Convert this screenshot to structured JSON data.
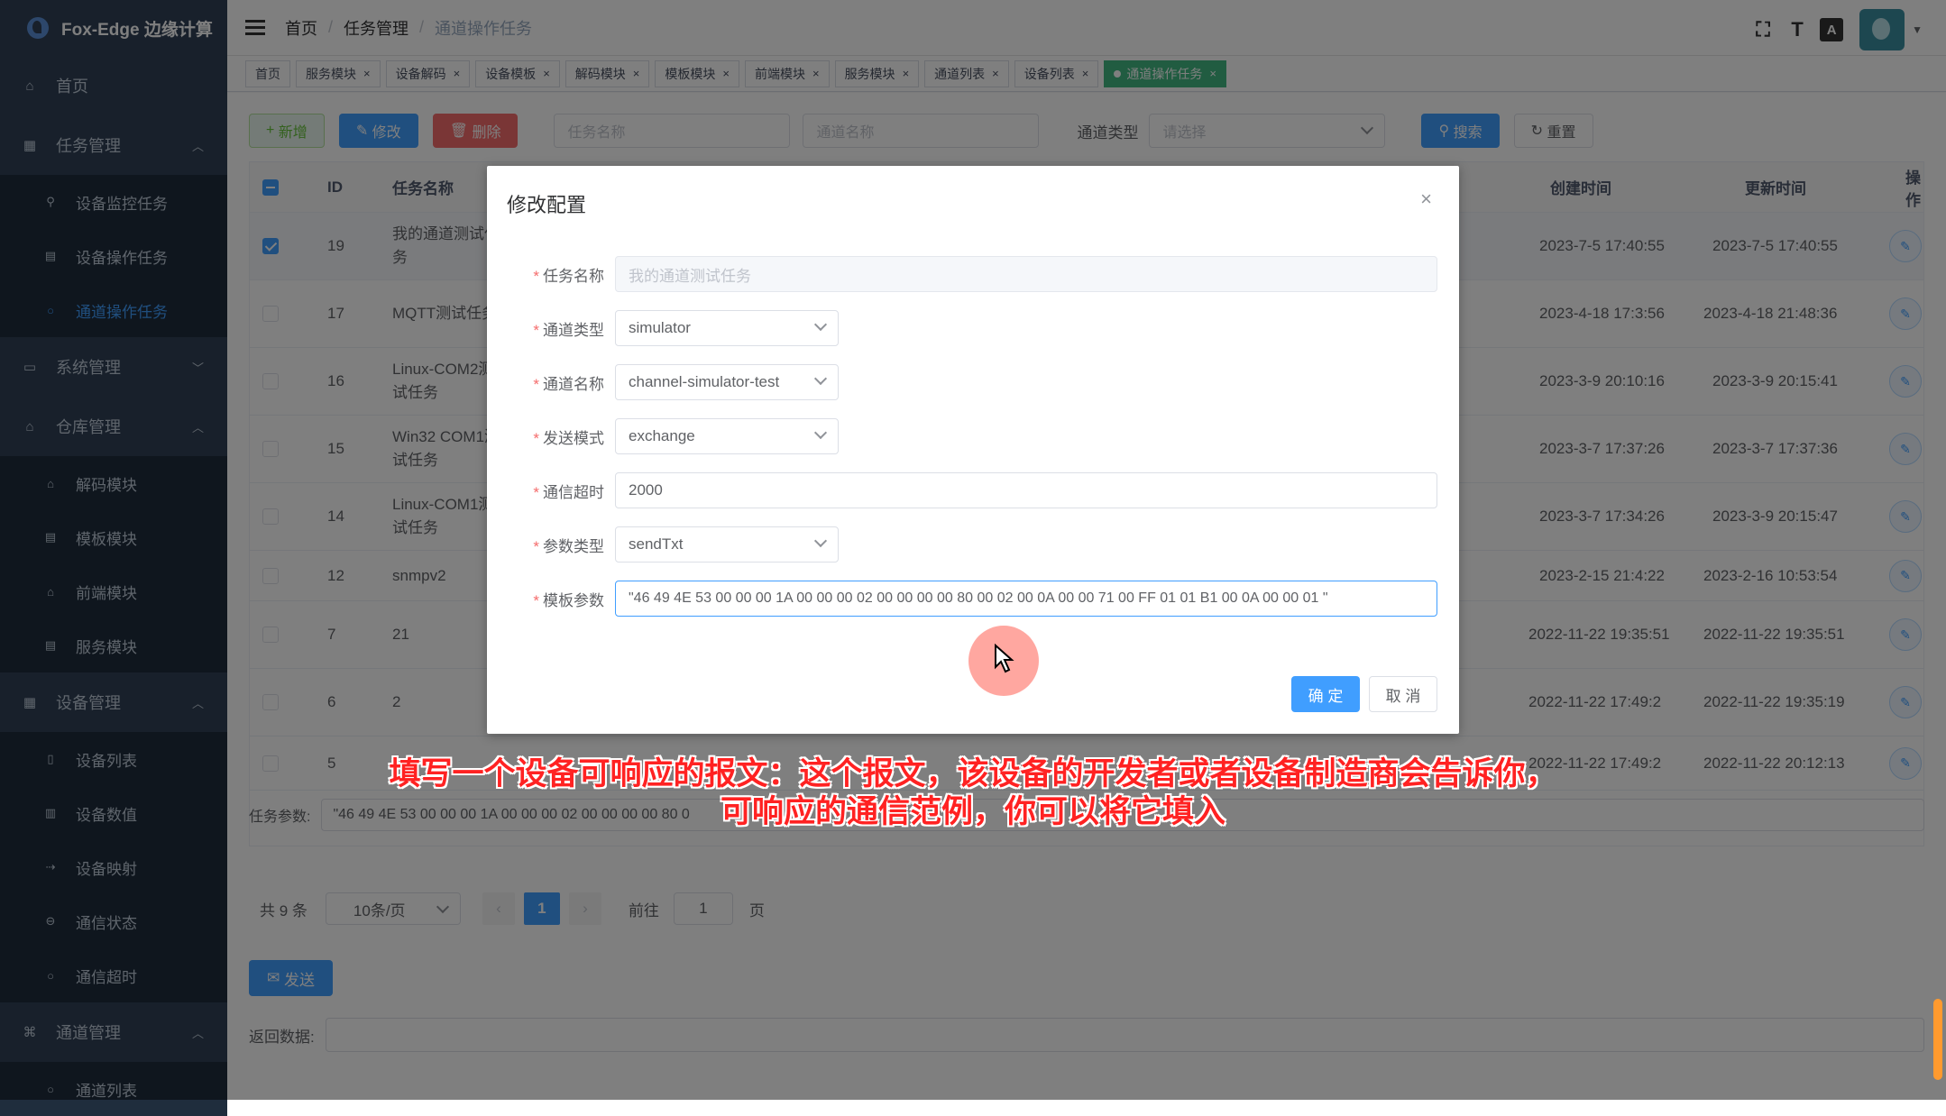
{
  "app": {
    "title": "Fox-Edge 边缘计算"
  },
  "sidebar": {
    "home": "首页",
    "task_mgmt": {
      "label": "任务管理",
      "items": [
        "设备监控任务",
        "设备操作任务",
        "通道操作任务"
      ]
    },
    "system_mgmt": "系统管理",
    "repo_mgmt": {
      "label": "仓库管理",
      "items": [
        "解码模块",
        "模板模块",
        "前端模块",
        "服务模块"
      ]
    },
    "device_mgmt": {
      "label": "设备管理",
      "items": [
        "设备列表",
        "设备数值",
        "设备映射",
        "通信状态",
        "通信超时"
      ]
    },
    "channel_mgmt": {
      "label": "通道管理",
      "items": [
        "通道列表"
      ]
    }
  },
  "header": {
    "breadcrumb": [
      "首页",
      "任务管理",
      "通道操作任务"
    ],
    "sep": "/",
    "font_icon_label": "A"
  },
  "tags": [
    "首页",
    "服务模块",
    "设备解码",
    "设备模板",
    "解码模块",
    "模板模块",
    "前端模块",
    "服务模块",
    "通道列表",
    "设备列表",
    "通道操作任务"
  ],
  "toolbar": {
    "add": "新增",
    "edit": "修改",
    "delete": "删除",
    "task_name_ph": "任务名称",
    "channel_name_ph": "通道名称",
    "channel_type_label": "通道类型",
    "channel_type_ph": "请选择",
    "search": "搜索",
    "reset": "重置"
  },
  "table": {
    "headers": {
      "id": "ID",
      "name": "任务名称",
      "created": "创建时间",
      "updated": "更新时间",
      "ops": "操作"
    },
    "rows": [
      {
        "id": "19",
        "name": "我的通道测试任务",
        "created": "2023-7-5 17:40:55",
        "updated": "2023-7-5 17:40:55",
        "checked": true
      },
      {
        "id": "17",
        "name": "MQTT测试任务",
        "created": "2023-4-18 17:3:56",
        "updated": "2023-4-18 21:48:36",
        "checked": false
      },
      {
        "id": "16",
        "name": "Linux-COM2测试任务",
        "created": "2023-3-9 20:10:16",
        "updated": "2023-3-9 20:15:41",
        "checked": false
      },
      {
        "id": "15",
        "name": "Win32 COM1测试任务",
        "created": "2023-3-7 17:37:26",
        "updated": "2023-3-7 17:37:36",
        "checked": false
      },
      {
        "id": "14",
        "name": "Linux-COM1测试任务",
        "created": "2023-3-7 17:34:26",
        "updated": "2023-3-9 20:15:47",
        "checked": false
      },
      {
        "id": "12",
        "name": "snmpv2",
        "created": "2023-2-15 21:4:22",
        "updated": "2023-2-16 10:53:54",
        "checked": false
      },
      {
        "id": "7",
        "name": "21",
        "created": "2022-11-22 19:35:51",
        "updated": "2022-11-22 19:35:51",
        "checked": false
      },
      {
        "id": "6",
        "name": "2",
        "created": "2022-11-22 17:49:2",
        "updated": "2022-11-22 19:35:19",
        "checked": false
      },
      {
        "id": "5",
        "name": "",
        "created": "2022-11-22 17:49:2",
        "updated": "2022-11-22 20:12:13",
        "checked": false
      }
    ]
  },
  "params": {
    "label": "任务参数:",
    "value": "\"46 49 4E 53 00 00 00 1A 00 00 00 02 00 00 00 00 80 0"
  },
  "pager": {
    "total": "共 9 条",
    "size": "10条/页",
    "current": "1",
    "goto": "前往",
    "goto_value": "1",
    "page": "页",
    "prev": "‹",
    "next": "›"
  },
  "send": "发送",
  "return_label": "返回数据:",
  "dialog": {
    "title": "修改配置",
    "close": "×",
    "fields": {
      "task_name": {
        "label": "任务名称",
        "value": "我的通道测试任务"
      },
      "channel_type": {
        "label": "通道类型",
        "value": "simulator"
      },
      "channel_name": {
        "label": "通道名称",
        "value": "channel-simulator-test"
      },
      "send_mode": {
        "label": "发送模式",
        "value": "exchange"
      },
      "timeout": {
        "label": "通信超时",
        "value": "2000"
      },
      "param_type": {
        "label": "参数类型",
        "value": "sendTxt"
      },
      "template_param": {
        "label": "模板参数",
        "value": "\"46 49 4E 53 00 00 00 1A 00 00 00 02 00 00 00 00 80 00 02 00 0A 00 00 71 00 FF 01 01 B1 00 0A 00 00 01 \""
      }
    },
    "ok": "确 定",
    "cancel": "取 消"
  },
  "subtitle": {
    "line1": "填写一个设备可响应的报文：这个报文，该设备的开发者或者设备制造商会告诉你，",
    "line2": "可响应的通信范例，你可以将它填入"
  },
  "colors": {
    "sidebar": "#304156",
    "primary": "#409eff",
    "danger": "#f56c6c",
    "success": "#67c23a",
    "subtitle": "#ff2222"
  }
}
